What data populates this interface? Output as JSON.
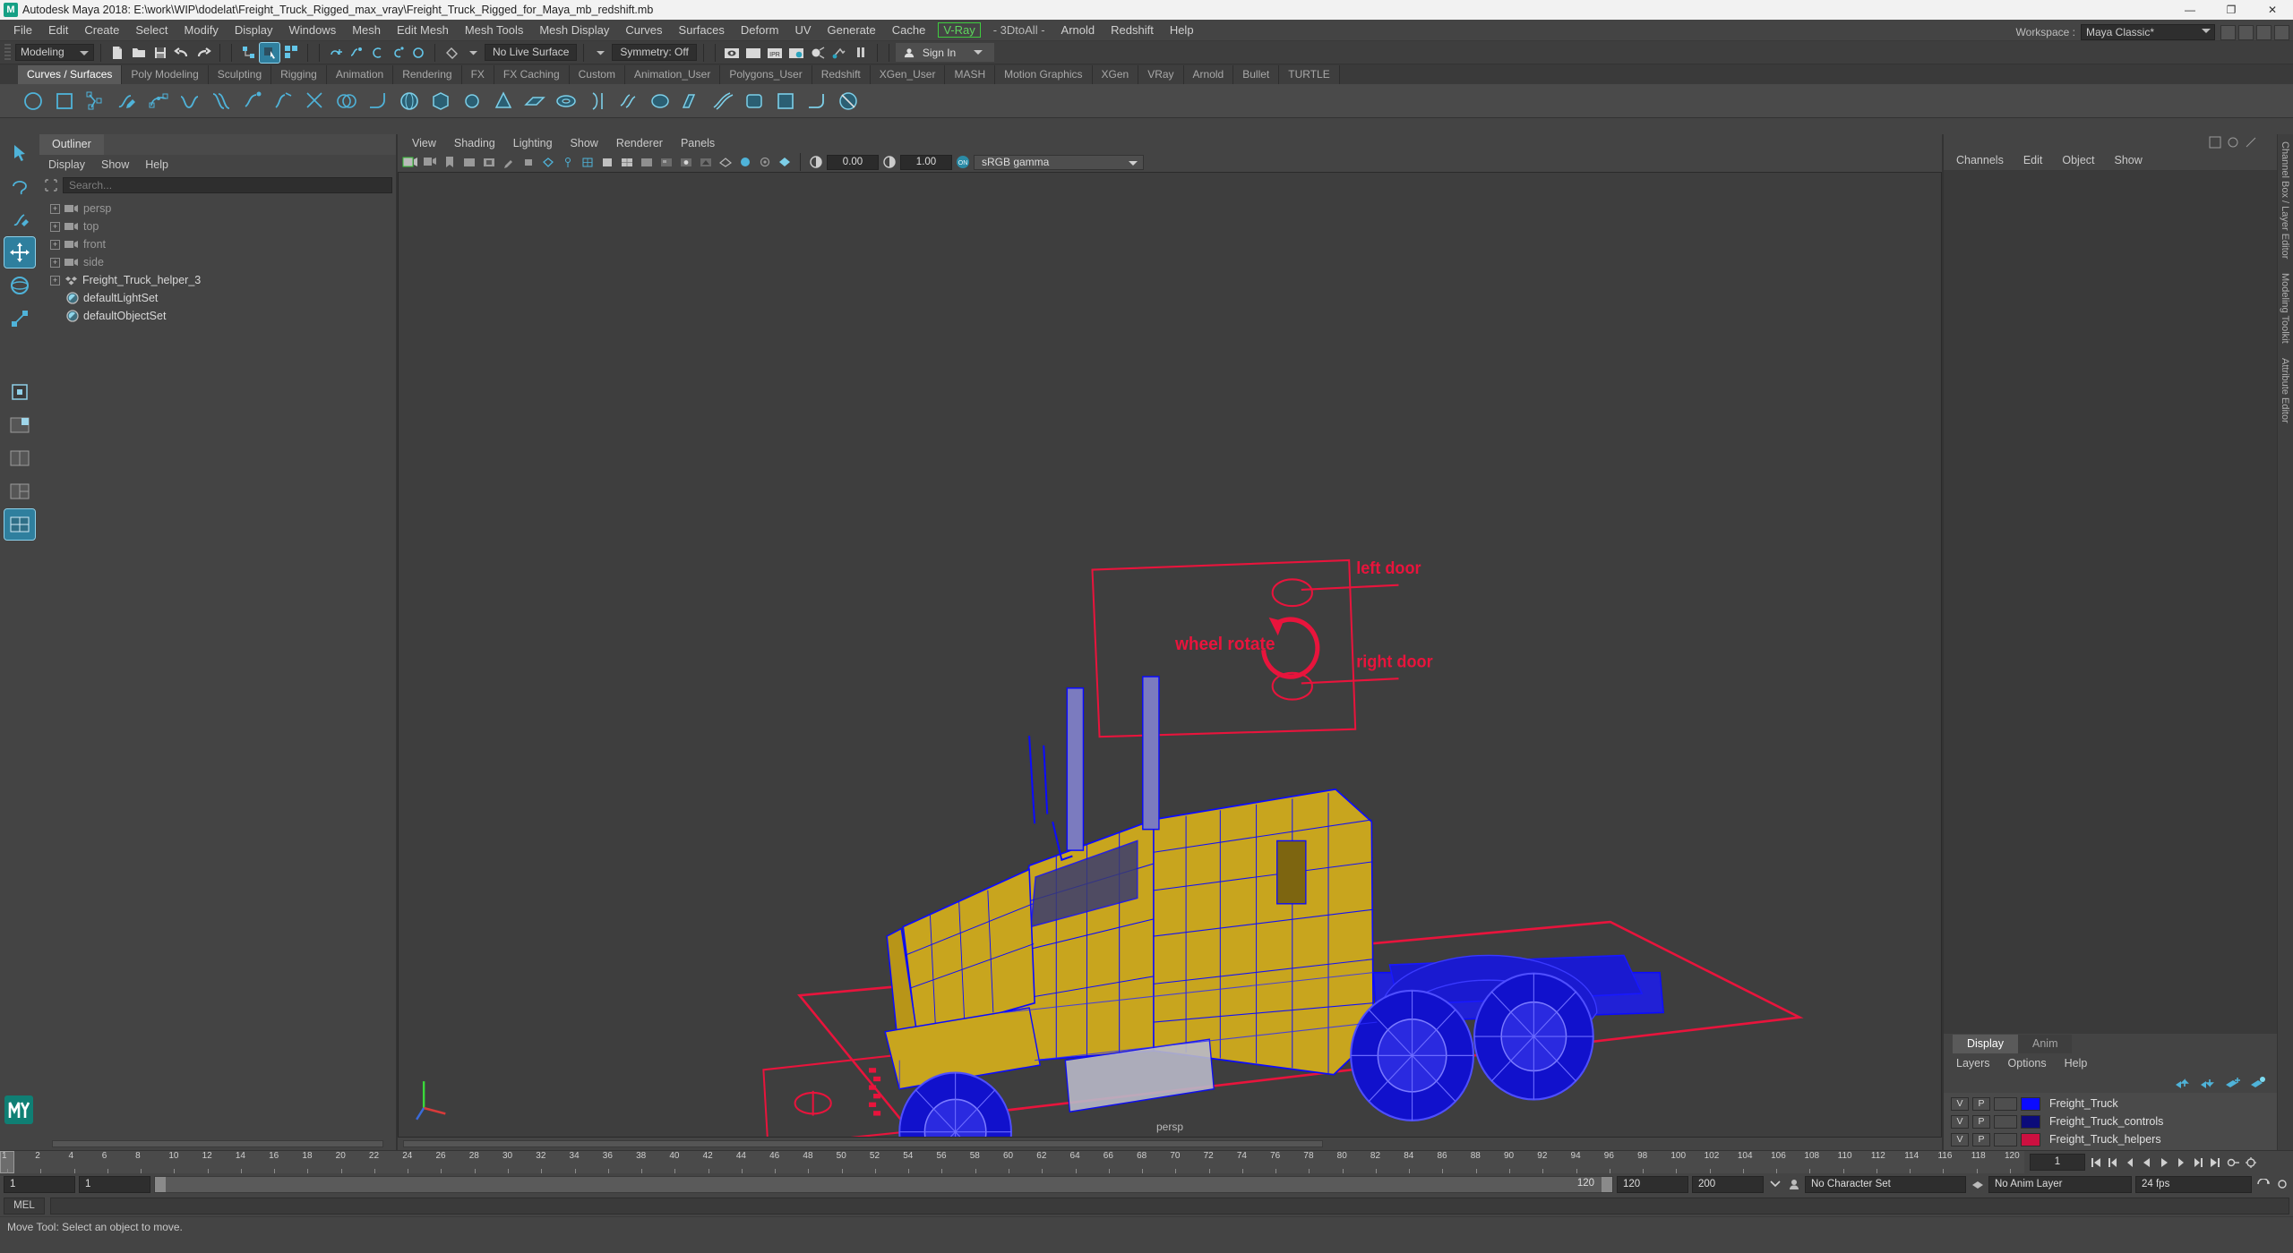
{
  "title_bar": {
    "app_title": "Autodesk Maya 2018: E:\\work\\WIP\\dodelat\\Freight_Truck_Rigged_max_vray\\Freight_Truck_Rigged_for_Maya_mb_redshift.mb",
    "logo_text": "M",
    "minimize": "—",
    "maximize": "❐",
    "close": "✕"
  },
  "menu_bar": {
    "items": [
      "File",
      "Edit",
      "Create",
      "Select",
      "Modify",
      "Display",
      "Windows",
      "Mesh",
      "Edit Mesh",
      "Mesh Tools",
      "Mesh Display",
      "Curves",
      "Surfaces",
      "Deform",
      "UV",
      "Generate",
      "Cache"
    ],
    "vray_item": "V-Ray",
    "items_after": [
      "- 3DtoAll -",
      "Arnold",
      "Redshift",
      "Help"
    ],
    "workspace_label": "Workspace :",
    "workspace_value": "Maya Classic*"
  },
  "status_line": {
    "mode_value": "Modeling",
    "live_surface": "No Live Surface",
    "symmetry": "Symmetry: Off",
    "sign_in": "Sign In"
  },
  "shelf": {
    "tabs": [
      "Curves / Surfaces",
      "Poly Modeling",
      "Sculpting",
      "Rigging",
      "Animation",
      "Rendering",
      "FX",
      "FX Caching",
      "Custom",
      "Animation_User",
      "Polygons_User",
      "Redshift",
      "XGen_User",
      "MASH",
      "Motion Graphics",
      "XGen",
      "VRay",
      "Arnold",
      "Bullet",
      "TURTLE"
    ],
    "selected_tab": "Curves / Surfaces"
  },
  "outliner": {
    "tab_label": "Outliner",
    "menus": [
      "Display",
      "Show",
      "Help"
    ],
    "search_placeholder": "Search...",
    "items": [
      {
        "label": "persp",
        "type": "camera",
        "expandable": true,
        "dim": true
      },
      {
        "label": "top",
        "type": "camera",
        "expandable": true,
        "dim": true
      },
      {
        "label": "front",
        "type": "camera",
        "expandable": true,
        "dim": true
      },
      {
        "label": "side",
        "type": "camera",
        "expandable": true,
        "dim": true
      },
      {
        "label": "Freight_Truck_helper_3",
        "type": "group",
        "expandable": true,
        "dim": false
      },
      {
        "label": "defaultLightSet",
        "type": "set",
        "expandable": false,
        "dim": false
      },
      {
        "label": "defaultObjectSet",
        "type": "set",
        "expandable": false,
        "dim": false
      }
    ]
  },
  "viewport": {
    "menus": [
      "View",
      "Shading",
      "Lighting",
      "Show",
      "Renderer",
      "Panels"
    ],
    "exposure_value": "0.00",
    "gamma_value": "1.00",
    "color_profile": "sRGB gamma",
    "camera_label": "persp",
    "annotations": {
      "wheel_rotate": "wheel rotate",
      "left_door": "left door",
      "right_door": "right door"
    },
    "colors": {
      "body_yellow": "#c8a51e",
      "wireframe_blue": "#0b0bff",
      "helper_red": "#e8143c",
      "background": "#3e3e3e"
    }
  },
  "right_panel": {
    "channel_menus": [
      "Channels",
      "Edit",
      "Object",
      "Show"
    ],
    "side_tabs": [
      "Channel Box / Layer Editor",
      "Modeling Toolkit",
      "Attribute Editor"
    ],
    "layer_tabs": [
      "Display",
      "Anim"
    ],
    "selected_layer_tab": "Display",
    "layer_menus": [
      "Layers",
      "Options",
      "Help"
    ],
    "layers": [
      {
        "visible": "V",
        "playback": "P",
        "color": "#0b0bff",
        "name": "Freight_Truck"
      },
      {
        "visible": "V",
        "playback": "P",
        "color": "#0b0b7a",
        "name": "Freight_Truck_controls"
      },
      {
        "visible": "V",
        "playback": "P",
        "color": "#cc1040",
        "name": "Freight_Truck_helpers"
      }
    ]
  },
  "timeline": {
    "ticks": [
      "1",
      "2",
      "4",
      "6",
      "8",
      "10",
      "12",
      "14",
      "16",
      "18",
      "20",
      "22",
      "24",
      "26",
      "28",
      "30",
      "32",
      "34",
      "36",
      "38",
      "40",
      "42",
      "44",
      "46",
      "48",
      "50",
      "52",
      "54",
      "56",
      "58",
      "60",
      "62",
      "64",
      "66",
      "68",
      "70",
      "72",
      "74",
      "76",
      "78",
      "80",
      "82",
      "84",
      "86",
      "88",
      "90",
      "92",
      "94",
      "96",
      "98",
      "100",
      "102",
      "104",
      "106",
      "108",
      "110",
      "112",
      "114",
      "116",
      "118",
      "120"
    ],
    "current_frame": "1",
    "start_field": "1",
    "end_field": "1",
    "anim_start": "1",
    "anim_end": "120",
    "playback_start": "120",
    "playback_end": "200",
    "character_set": "No Character Set",
    "anim_layer": "No Anim Layer",
    "fps": "24 fps",
    "frame_current_right": "1"
  },
  "command_line": {
    "language": "MEL",
    "value": ""
  },
  "help_line": {
    "text": "Move Tool: Select an object to move."
  }
}
